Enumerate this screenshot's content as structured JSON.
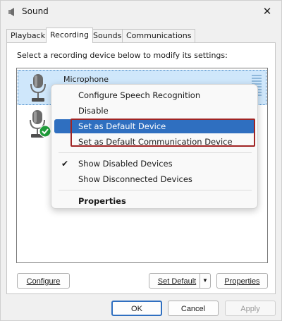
{
  "window": {
    "title": "Sound",
    "close_glyph": "✕"
  },
  "tabs": [
    {
      "label": "Playback"
    },
    {
      "label": "Recording",
      "active": true
    },
    {
      "label": "Sounds"
    },
    {
      "label": "Communications"
    }
  ],
  "panel": {
    "instruction": "Select a recording device below to modify its settings:"
  },
  "devices": [
    {
      "name": "Microphone",
      "selected": true
    },
    {
      "name": "",
      "selected": false,
      "status": "default"
    }
  ],
  "context_menu": {
    "items": [
      {
        "label": "Configure Speech Recognition"
      },
      {
        "label": "Disable"
      },
      {
        "label": "Set as Default Device",
        "highlighted": true
      },
      {
        "label": "Set as Default Communication Device"
      },
      {
        "label": "Show Disabled Devices",
        "checked": true
      },
      {
        "label": "Show Disconnected Devices"
      },
      {
        "label": "Properties",
        "bold": true
      }
    ],
    "check_glyph": "✔"
  },
  "panel_buttons": {
    "configure": "Configure",
    "set_default": "Set Default",
    "set_default_arrow": "▼",
    "properties": "Properties"
  },
  "footer": {
    "ok": "OK",
    "cancel": "Cancel",
    "apply": "Apply"
  },
  "colors": {
    "accent": "#2f6fc0",
    "selection": "#cfe7fb",
    "annotation": "#a02424",
    "default_check": "#1f9d3a"
  },
  "icons": {
    "app": "speaker-icon",
    "device": "microphone-icon",
    "status": "green-check-icon",
    "menu_check": "checkmark-icon",
    "dropdown": "chevron-down-icon"
  }
}
